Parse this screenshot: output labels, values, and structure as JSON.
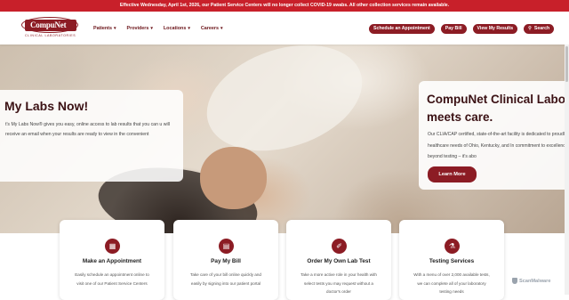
{
  "alert": {
    "text": "Effective Wednesday, April 1st, 2026, our Patient Service Centers will no longer collect COVID-19 swabs. All other collection services remain available."
  },
  "logo": {
    "name": "CompuNet",
    "tagline": "CLINICAL LABORATORIES"
  },
  "nav": [
    {
      "label": "Patients"
    },
    {
      "label": "Providers"
    },
    {
      "label": "Locations"
    },
    {
      "label": "Careers"
    }
  ],
  "header_buttons": {
    "schedule": "Schedule an Appointment",
    "pay": "Pay Bill",
    "results": "View My Results",
    "search": "Search"
  },
  "hero_left": {
    "title": "My Labs Now!",
    "body": "t's My Labs Now® gives you easy, online access to lab results that you can u will receive an email when your results are ready to view in the convenient"
  },
  "hero_right": {
    "title_line1": "CompuNet Clinical Labo",
    "title_line2": "meets care.",
    "body": "Our CLIA/CAP certified, state-of-the-art facility is dedicated to proudly serve the healthcare needs of Ohio, Kentucky, and In commitment to excellence that goes beyond testing – it's abo",
    "button": "Learn More"
  },
  "services": [
    {
      "icon": "calendar-icon",
      "glyph": "▦",
      "title": "Make an Appointment",
      "text": "Easily schedule an appointment online to visit one of our Patient Service Centers"
    },
    {
      "icon": "bill-icon",
      "glyph": "▤",
      "title": "Pay My Bill",
      "text": "Take care of your bill online quickly and easily by signing into our patient portal"
    },
    {
      "icon": "test-tube-icon",
      "glyph": "✐",
      "title": "Order My Own Lab Test",
      "text": "Take a more active role in your health with select tests you may request without a doctor's order"
    },
    {
      "icon": "lab-flask-icon",
      "glyph": "⚗",
      "title": "Testing Services",
      "text": "With a menu of over 2,000 available tests, we can complete all of your laboratory testing needs"
    }
  ],
  "watermark": "ScanMalware"
}
